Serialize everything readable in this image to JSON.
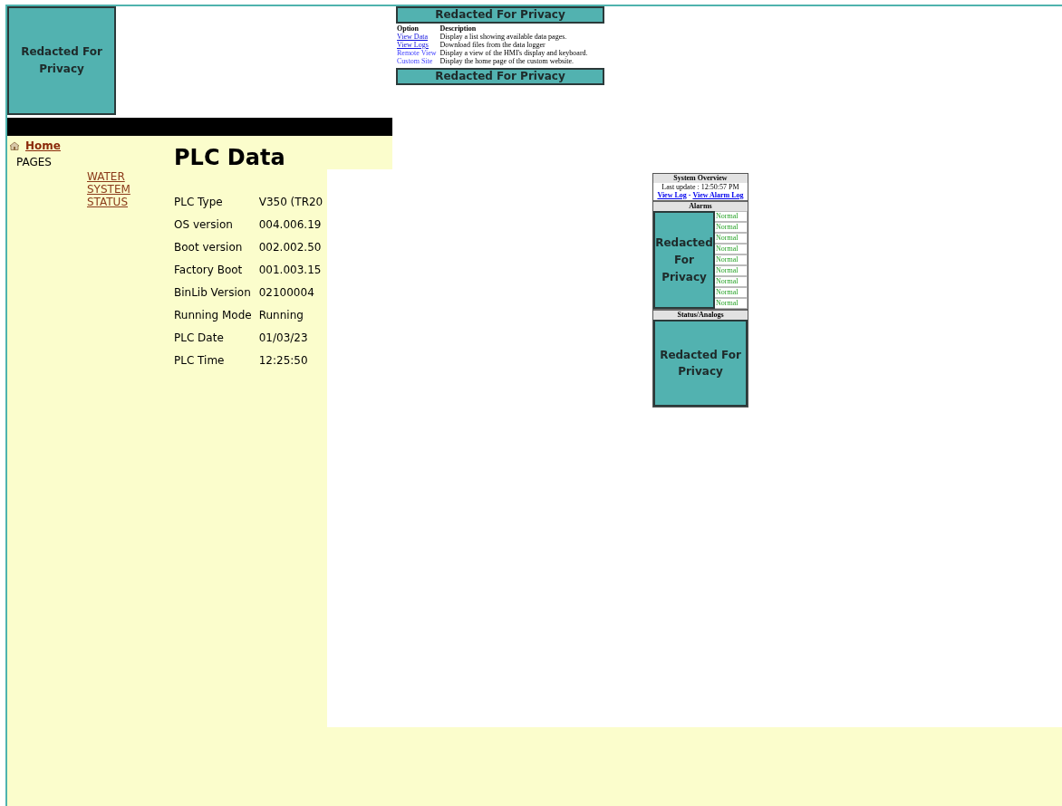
{
  "logo": {
    "text": "Redacted For Privacy"
  },
  "options_panel": {
    "header": "Redacted For Privacy",
    "columns": [
      "Option",
      "Description"
    ],
    "rows": [
      {
        "option": "View Data",
        "description": "Display a list showing available data pages."
      },
      {
        "option": "View Logs",
        "description": "Download files from the data logger"
      },
      {
        "option": "Remote View",
        "description": "Display a view of the HMI's display and keyboard."
      },
      {
        "option": "Custom Site",
        "description": "Display the home page of the custom website."
      }
    ],
    "footer": "Redacted For Privacy"
  },
  "nav": {
    "home": "Home",
    "section": "PAGES",
    "links": [
      "WATER SYSTEM STATUS"
    ]
  },
  "plc": {
    "title": "PLC Data",
    "rows": [
      {
        "label": "PLC Type",
        "value": "V350 (TR20"
      },
      {
        "label": "OS version",
        "value": "004.006.19"
      },
      {
        "label": "Boot version",
        "value": "002.002.50"
      },
      {
        "label": "Factory Boot",
        "value": "001.003.15"
      },
      {
        "label": "BinLib Version",
        "value": "02100004"
      },
      {
        "label": "Running Mode",
        "value": "Running"
      },
      {
        "label": "PLC Date",
        "value": "01/03/23"
      },
      {
        "label": "PLC Time",
        "value": "12:25:50"
      }
    ]
  },
  "overview": {
    "title": "System Overview",
    "last_update": "Last update : 12:50:57 PM",
    "links": [
      "View Log",
      "View Alarm Log"
    ],
    "separator": "-",
    "alarms_header": "Alarms",
    "alarms_redacted": "Redacted For Privacy",
    "alarms": [
      "Normal",
      "Normal",
      "Normal",
      "Normal",
      "Normal",
      "Normal",
      "Normal",
      "Normal",
      "Normal"
    ],
    "status_header": "Status/Analogs",
    "status_redacted": "Redacted For Privacy"
  }
}
